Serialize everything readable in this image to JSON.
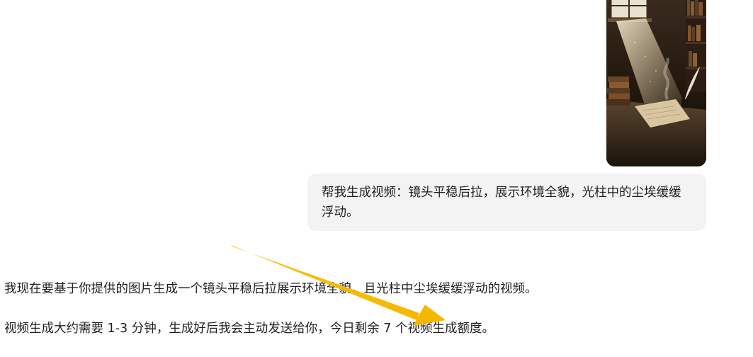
{
  "user_message": {
    "image_icon": "library-scene-image",
    "text": "帮我生成视频：镜头平稳后拉，展示环境全貌，光柱中的尘埃缓缓浮动。"
  },
  "assistant_message": {
    "paragraphs": [
      "我现在要基于你提供的图片生成一个镜头平稳后拉展示环境全貌，且光柱中尘埃缓缓浮动的视频。",
      "视频生成大约需要 1-3 分钟，生成好后我会主动发送给你，今日剩余 7 个视频生成额度。"
    ]
  },
  "colors": {
    "bubble_bg": "#f3f3f3",
    "arrow": "#f5b800",
    "text": "#1f1f1f"
  }
}
